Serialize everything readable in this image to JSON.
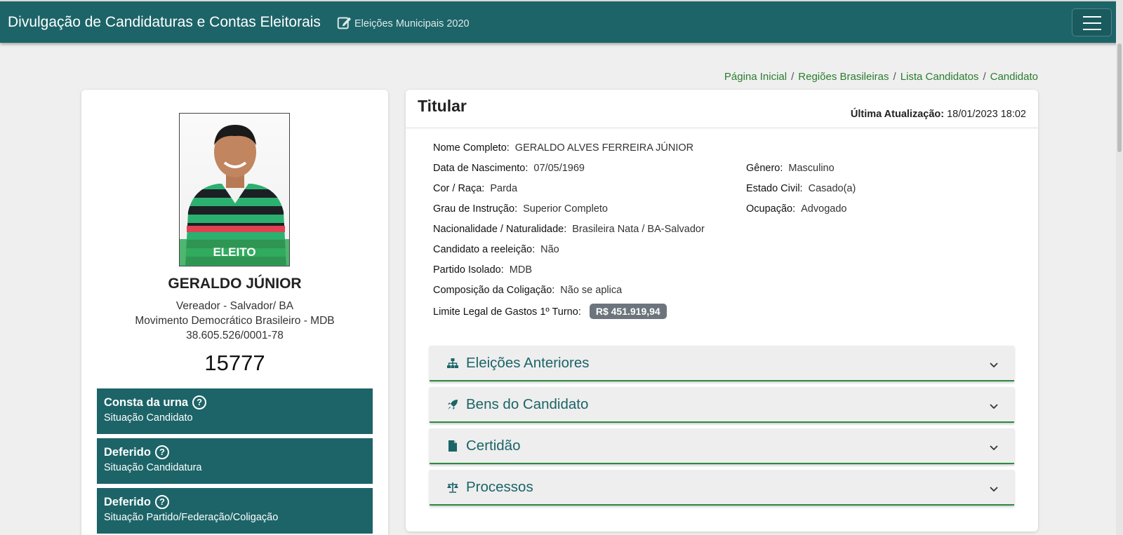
{
  "header": {
    "app_title": "Divulgação de Candidaturas e Contas Eleitorais",
    "election": "Eleições Municipais 2020",
    "menu_icon": "hamburger-icon",
    "color": "#1c6468"
  },
  "breadcrumb": [
    "Página Inicial",
    "Regiões Brasileiras",
    "Lista Candidatos",
    "Candidato"
  ],
  "candidate": {
    "badge": "ELEITO",
    "name": "GERALDO JÚNIOR",
    "office": "Vereador - Salvador/ BA",
    "party": "Movimento Democrático Brasileiro - MDB",
    "cnpj": "38.605.526/0001-78",
    "number": "15777",
    "status": [
      {
        "title": "Consta da urna",
        "subtitle": "Situação Candidato"
      },
      {
        "title": "Deferido",
        "subtitle": "Situação Candidatura"
      },
      {
        "title": "Deferido",
        "subtitle": "Situação Partido/Federação/Coligação"
      }
    ]
  },
  "details": {
    "card_title": "Titular",
    "updated_label": "Última Atualização:",
    "updated_value": "18/01/2023 18:02",
    "full_name": {
      "label": "Nome Completo:",
      "value": "GERALDO ALVES FERREIRA JÚNIOR"
    },
    "birth": {
      "label": "Data de Nascimento:",
      "value": "07/05/1969"
    },
    "race": {
      "label": "Cor / Raça:",
      "value": "Parda"
    },
    "education": {
      "label": "Grau de Instrução:",
      "value": "Superior Completo"
    },
    "nationality": {
      "label": "Nacionalidade / Naturalidade:",
      "value": "Brasileira Nata / BA-Salvador"
    },
    "reelection": {
      "label": "Candidato a reeleição:",
      "value": "Não"
    },
    "party_single": {
      "label": "Partido Isolado:",
      "value": "MDB"
    },
    "coalition": {
      "label": "Composição da Coligação:",
      "value": "Não se aplica"
    },
    "spending_limit": {
      "label": "Limite Legal de Gastos 1º Turno:",
      "value": "R$ 451.919,94"
    },
    "gender": {
      "label": "Gênero:",
      "value": "Masculino"
    },
    "marital": {
      "label": "Estado Civil:",
      "value": "Casado(a)"
    },
    "occupation": {
      "label": "Ocupação:",
      "value": "Advogado"
    }
  },
  "accordions": [
    {
      "label": "Eleições Anteriores",
      "icon": "sitemap-icon"
    },
    {
      "label": "Bens do Candidato",
      "icon": "rocket-icon"
    },
    {
      "label": "Certidão",
      "icon": "document-icon"
    },
    {
      "label": "Processos",
      "icon": "balance-scale-icon"
    }
  ]
}
